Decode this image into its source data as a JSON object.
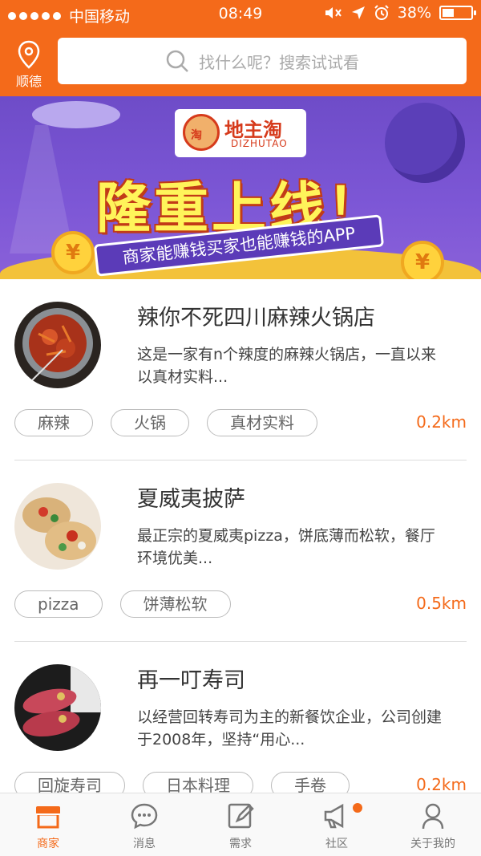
{
  "status_bar": {
    "carrier": "中国移动",
    "time": "08:49",
    "battery": "38%",
    "battery_level": 0.38
  },
  "header": {
    "location_label": "顺德",
    "search_placeholder": "找什么呢？搜索试试看"
  },
  "banner": {
    "logo_title": "地主淘",
    "logo_subtitle": "DIZHUTAO",
    "logo_badge": "淘",
    "headline": "隆重上线！",
    "tagline": "商家能赚钱买家也能赚钱的APP",
    "coin_symbol": "¥"
  },
  "shops": [
    {
      "name": "辣你不死四川麻辣火锅店",
      "desc": "这是一家有n个辣度的麻辣火锅店，一直以来以真材实料...",
      "tags": [
        "麻辣",
        "火锅",
        "真材实料"
      ],
      "distance": "0.2km"
    },
    {
      "name": "夏威夷披萨",
      "desc": "最正宗的夏威夷pizza，饼底薄而松软，餐厅环境优美...",
      "tags": [
        "pizza",
        "饼薄松软"
      ],
      "distance": "0.5km"
    },
    {
      "name": "再一叮寿司",
      "desc": "以经营回转寿司为主的新餐饮企业，公司创建于2008年，坚持“用心...",
      "tags": [
        "回旋寿司",
        "日本料理",
        "手卷"
      ],
      "distance": "0.2km"
    }
  ],
  "tabbar": {
    "items": [
      {
        "label": "商家",
        "icon": "shop-icon",
        "active": true
      },
      {
        "label": "消息",
        "icon": "chat-icon",
        "active": false
      },
      {
        "label": "需求",
        "icon": "edit-icon",
        "active": false
      },
      {
        "label": "社区",
        "icon": "megaphone-icon",
        "active": false,
        "badge": true
      },
      {
        "label": "关于我的",
        "icon": "person-icon",
        "active": false
      }
    ]
  },
  "colors": {
    "accent": "#f46a1a",
    "banner": "#7d57d6"
  }
}
